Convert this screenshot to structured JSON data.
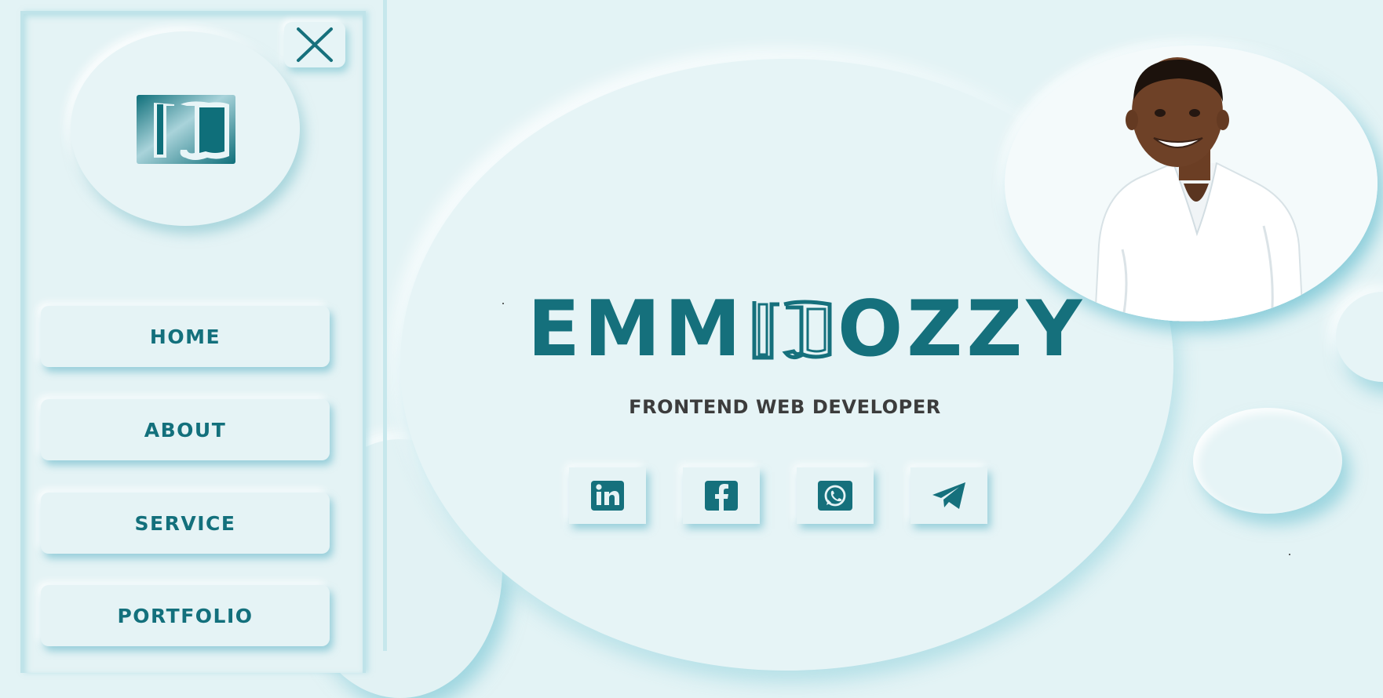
{
  "brand": {
    "left_text": "EMM",
    "right_text": "OZZY"
  },
  "subtitle": "FRONTEND WEB DEVELOPER",
  "nav": {
    "items": [
      {
        "label": "HOME"
      },
      {
        "label": "ABOUT"
      },
      {
        "label": "SERVICE"
      },
      {
        "label": "PORTFOLIO"
      }
    ]
  },
  "social": [
    "linkedin-icon",
    "facebook-icon",
    "whatsapp-icon",
    "telegram-icon"
  ],
  "colors": {
    "accent": "#15707c",
    "background": "#e3f3f5",
    "shadow": "#64becd",
    "text_dark": "#3c3c3c"
  }
}
